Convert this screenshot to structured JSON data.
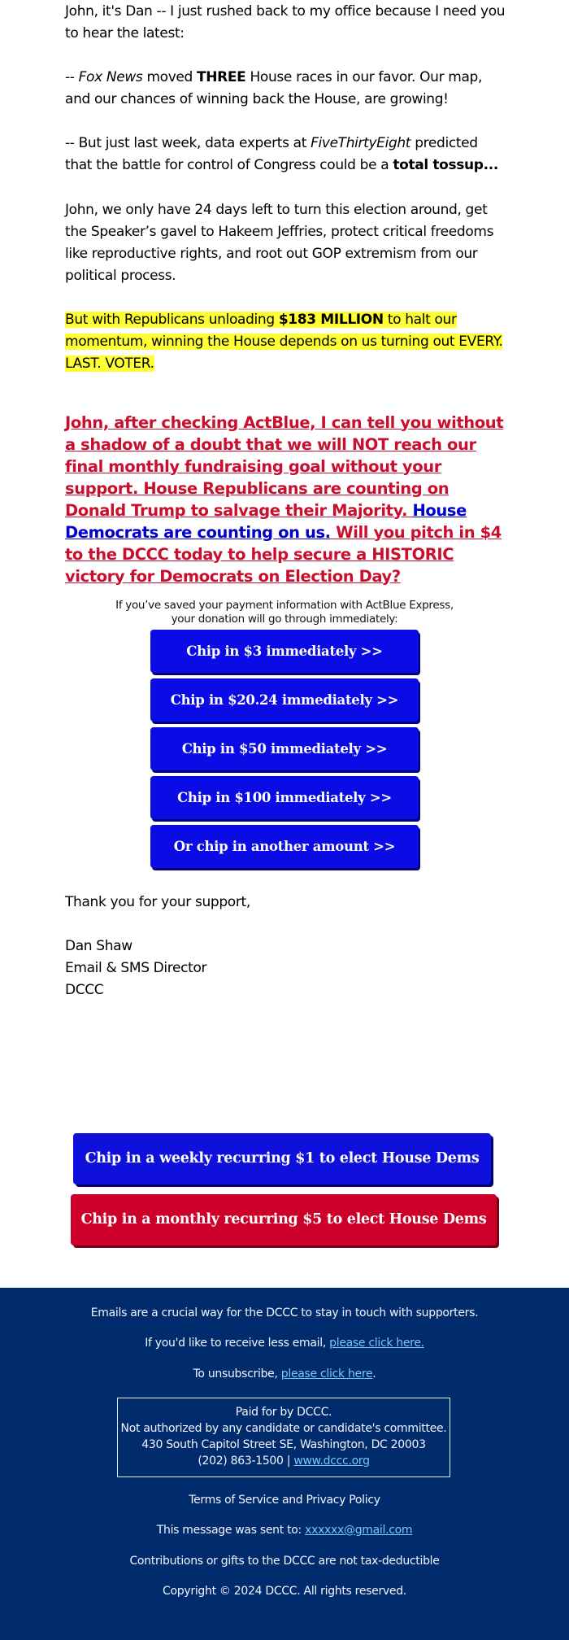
{
  "body": {
    "p1": "John, it's Dan -- I just rushed back to my office because I need you to hear the latest:",
    "p2": {
      "prefix": "-- ",
      "source": "Fox News",
      "mid1": " moved ",
      "emph": "THREE",
      "rest": " House races in our favor. Our map, and our chances of winning back the House, are growing!"
    },
    "p3": {
      "prefix": "-- But just last week, data experts at ",
      "source": "FiveThirtyEight",
      "mid": " predicted that the battle for control of Congress could be a ",
      "emph": "total tossup..."
    },
    "p4": "John, we only have 24 days left to turn this election around, get the Speaker’s gavel to Hakeem Jeffries, protect critical freedoms like reproductive rights, and root out GOP extremism from our political process.",
    "p5": {
      "pre": "But with Republicans unloading ",
      "emph": "$183 MILLION",
      "post": " to halt our momentum, winning the House depends on us turning out EVERY. LAST. VOTER."
    },
    "p6": {
      "red1": "John, after checking ActBlue, I can tell you without a shadow of a doubt that we will NOT reach our final monthly fundraising goal without your support. House Republicans are counting on Donald Trump to salvage their Majority. ",
      "blue": "House Democrats are counting on us.",
      "red2": " Will you pitch in $4 to the DCCC today to help secure a HISTORIC victory for Democrats on Election Day?"
    }
  },
  "express_note": {
    "line1": "If you’ve saved your payment information with ActBlue Express,",
    "line2": "your donation will go through immediately:"
  },
  "donate_buttons": [
    {
      "label": "Chip in $3 immediately >>"
    },
    {
      "label": "Chip in $20.24 immediately >>"
    },
    {
      "label": "Chip in $50 immediately >>"
    },
    {
      "label": "Chip in $100 immediately >>"
    },
    {
      "label": "Or chip in another amount >>"
    }
  ],
  "signoff": "Thank you for your support,",
  "signature": {
    "name": "Dan Shaw",
    "title": "Email & SMS Director",
    "org": "DCCC"
  },
  "recurring_buttons": {
    "weekly": "Chip in a weekly recurring $1 to elect House Dems >>",
    "monthly": "Chip in a monthly recurring $5 to elect House Dems >>"
  },
  "footer": {
    "line1": "Emails are a crucial way for the DCCC to stay in touch with supporters.",
    "less_email_prefix": "If you'd like to receive less email, ",
    "less_email_link": "please click here.",
    "unsub_prefix": "To unsubscribe, ",
    "unsub_link": "please click here",
    "unsub_suffix": ".",
    "paid": {
      "line1": "Paid for by DCCC.",
      "line2": "Not authorized by any candidate or candidate's committee.",
      "line3": "430 South Capitol Street SE, Washington, DC 20003",
      "phone": "(202) 863-1500 | ",
      "site_link": "www.dccc.org"
    },
    "terms": "Terms of Service and Privacy Policy",
    "sent_prefix": "This message was sent to: ",
    "sent_email": "xxxxxx@gmail.com",
    "tax": "Contributions or gifts to the DCCC are not tax-deductible",
    "copyright": "Copyright © 2024 DCCC. All rights reserved."
  },
  "colors": {
    "donate_blue": "#0b0be6",
    "recurring_red": "#cc0029",
    "headline_red": "#c8102e",
    "link_blue": "#0000cc",
    "highlight_yellow": "#ffff33",
    "footer_navy": "#002c6e",
    "footer_link": "#7cc6f5"
  }
}
